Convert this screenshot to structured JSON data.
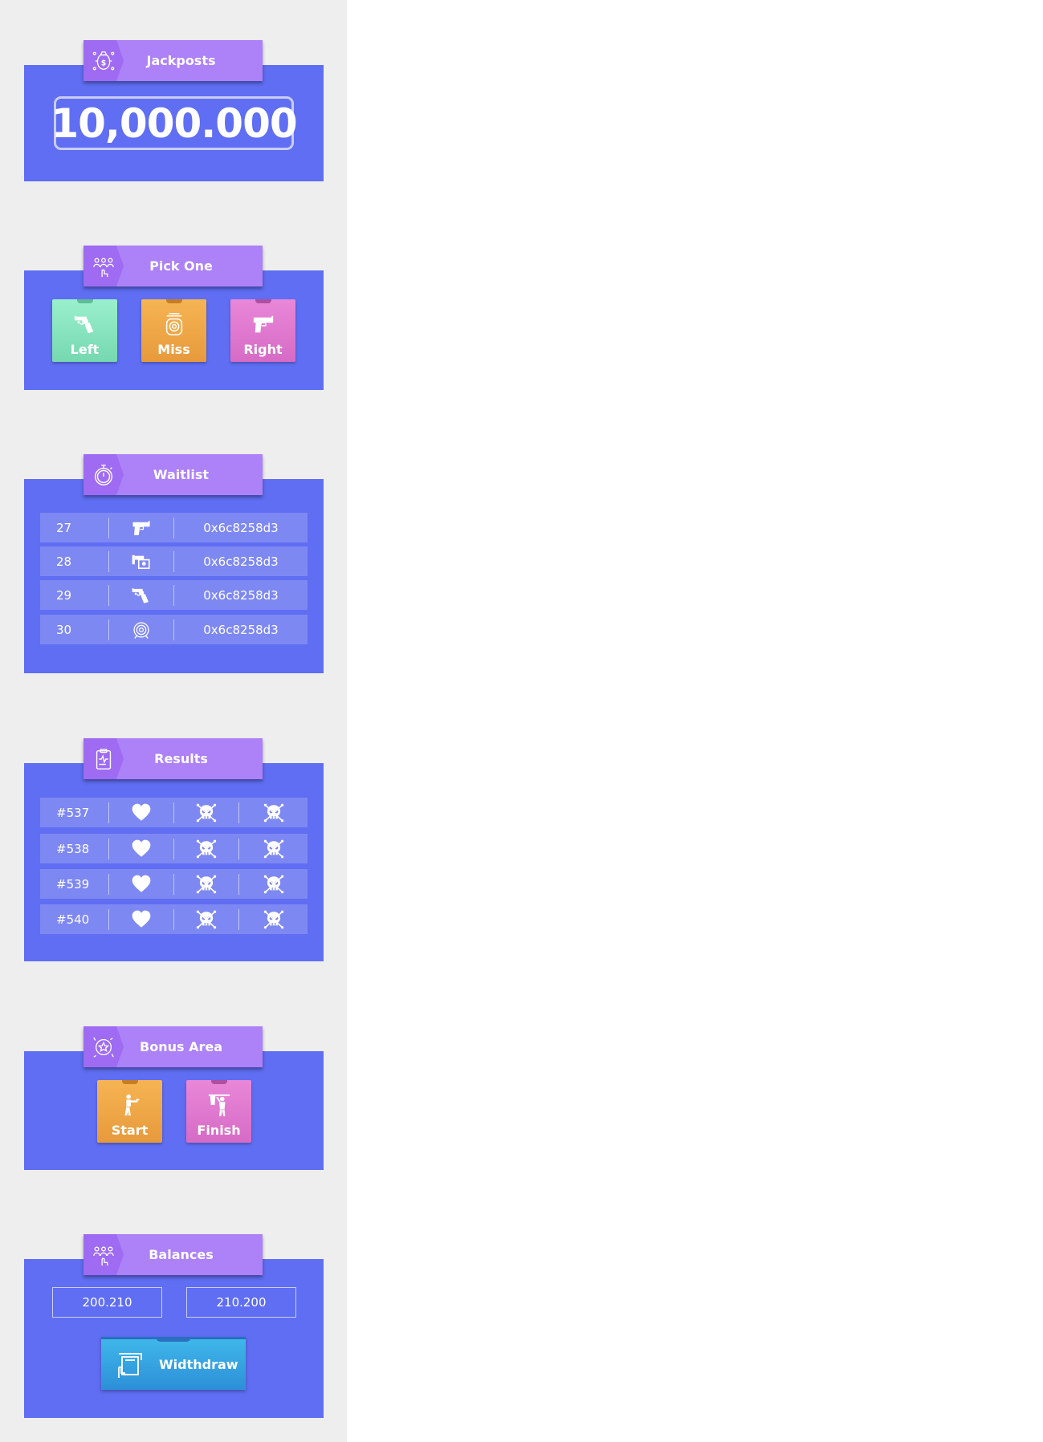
{
  "jackpots": {
    "title": "Jackposts",
    "icon": "money-bag-icon",
    "amount": "10,000.000"
  },
  "pick_one": {
    "title": "Pick One",
    "icon": "people-group-icon",
    "options": [
      {
        "label": "Left",
        "icon": "revolver-icon",
        "color": "#8fe9c4"
      },
      {
        "label": "Miss",
        "icon": "target-icon",
        "color": "#f2ad4e"
      },
      {
        "label": "Right",
        "icon": "pistol-icon",
        "color": "#e07fd1"
      }
    ]
  },
  "waitlist": {
    "title": "Waitlist",
    "icon": "stopwatch-icon",
    "rows": [
      {
        "id": "27",
        "icon": "pistol-icon",
        "address": "0x6c8258d3"
      },
      {
        "id": "28",
        "icon": "shield-gun-icon",
        "address": "0x6c8258d3"
      },
      {
        "id": "29",
        "icon": "revolver-icon",
        "address": "0x6c8258d3"
      },
      {
        "id": "30",
        "icon": "target-icon",
        "address": "0x6c8258d3"
      }
    ]
  },
  "results": {
    "title": "Results",
    "icon": "clipboard-icon",
    "rows": [
      {
        "round": "#537",
        "icons": [
          "heart-icon",
          "skull-icon",
          "skull-icon"
        ]
      },
      {
        "round": "#538",
        "icons": [
          "heart-icon",
          "skull-icon",
          "skull-icon"
        ]
      },
      {
        "round": "#539",
        "icons": [
          "heart-icon",
          "skull-icon",
          "skull-icon"
        ]
      },
      {
        "round": "#540",
        "icons": [
          "heart-icon",
          "skull-icon",
          "skull-icon"
        ]
      }
    ]
  },
  "bonus": {
    "title": "Bonus Area",
    "icon": "star-badge-icon",
    "options": [
      {
        "label": "Start",
        "icon": "gunman-icon",
        "color": "#f2ad4e"
      },
      {
        "label": "Finish",
        "icon": "hanged-man-icon",
        "color": "#e07fd1"
      }
    ]
  },
  "balances": {
    "title": "Balances",
    "icon": "people-group-icon",
    "values": [
      "200.210",
      "210.200"
    ],
    "withdraw_label": "Widthdraw",
    "withdraw_icon": "atm-icon"
  },
  "colors": {
    "panel": "#5f6ef2",
    "tab": "#ad81f7",
    "sidebar": "#eeeeee"
  }
}
